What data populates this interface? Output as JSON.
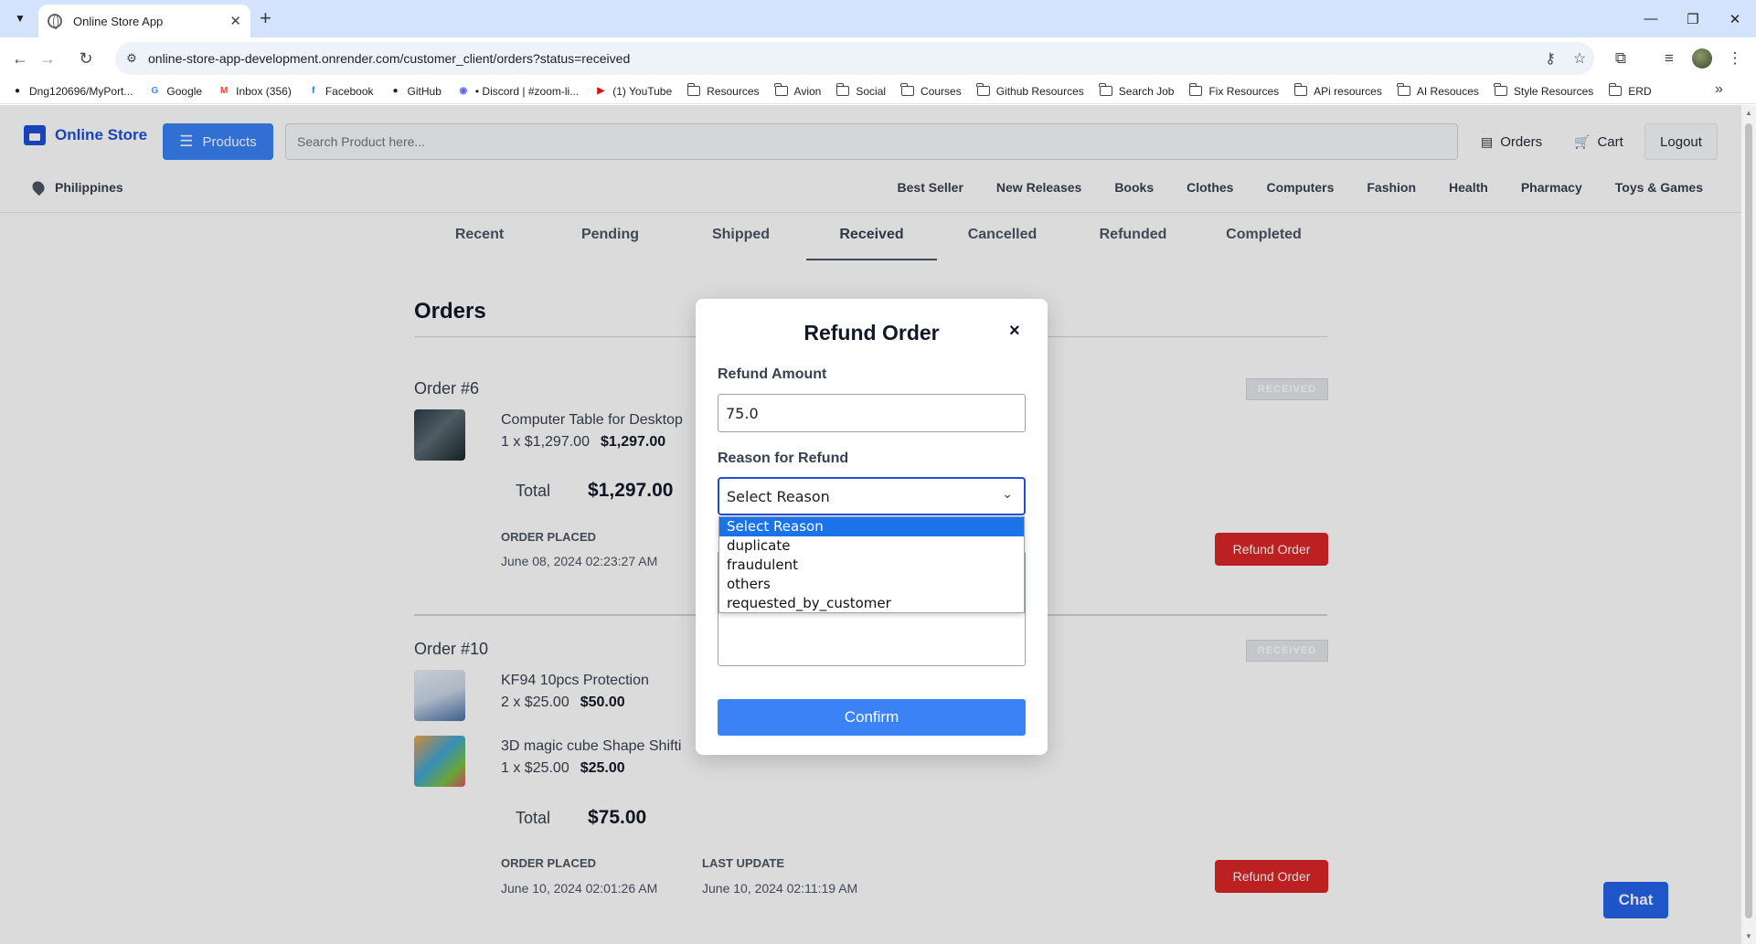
{
  "browser": {
    "tab_title": "Online Store App",
    "url": "online-store-app-development.onrender.com/customer_client/orders?status=received",
    "bookmarks": [
      {
        "label": "Dng120696/MyPort...",
        "icon": "github-icon"
      },
      {
        "label": "Google",
        "icon": "google-icon"
      },
      {
        "label": "Inbox (356)",
        "icon": "gmail-icon"
      },
      {
        "label": "Facebook",
        "icon": "facebook-icon"
      },
      {
        "label": "GitHub",
        "icon": "github-icon"
      },
      {
        "label": "• Discord | #zoom-li...",
        "icon": "discord-icon"
      },
      {
        "label": "(1) YouTube",
        "icon": "youtube-icon"
      },
      {
        "label": "Resources",
        "icon": "folder-icon"
      },
      {
        "label": "Avion",
        "icon": "folder-icon"
      },
      {
        "label": "Social",
        "icon": "folder-icon"
      },
      {
        "label": "Courses",
        "icon": "folder-icon"
      },
      {
        "label": "Github Resources",
        "icon": "folder-icon"
      },
      {
        "label": "Search Job",
        "icon": "folder-icon"
      },
      {
        "label": "Fix Resources",
        "icon": "folder-icon"
      },
      {
        "label": "APi resources",
        "icon": "folder-icon"
      },
      {
        "label": "AI Resouces",
        "icon": "folder-icon"
      },
      {
        "label": "Style Resources",
        "icon": "folder-icon"
      },
      {
        "label": "ERD",
        "icon": "folder-icon"
      }
    ]
  },
  "header": {
    "brand": "Online Store",
    "products_label": "Products",
    "search_placeholder": "Search Product here...",
    "orders_label": "Orders",
    "cart_label": "Cart",
    "logout_label": "Logout",
    "location": "Philippines",
    "categories": [
      "Best Seller",
      "New Releases",
      "Books",
      "Clothes",
      "Computers",
      "Fashion",
      "Health",
      "Pharmacy",
      "Toys & Games"
    ]
  },
  "status_tabs": {
    "items": [
      "Recent",
      "Pending",
      "Shipped",
      "Received",
      "Cancelled",
      "Refunded",
      "Completed"
    ],
    "active": "Received"
  },
  "orders": {
    "title": "Orders",
    "list": [
      {
        "label": "Order #6",
        "badge": "RECEIVED",
        "items": [
          {
            "name": "Computer Table for Desktop",
            "qty": "1 x $1,297.00",
            "subtotal": "$1,297.00"
          }
        ],
        "total_label": "Total",
        "total": "$1,297.00",
        "placed_label": "ORDER PLACED",
        "placed": "June 08, 2024 02:23:27 AM",
        "refund_label": "Refund Order"
      },
      {
        "label": "Order #10",
        "badge": "RECEIVED",
        "items": [
          {
            "name": "KF94 10pcs Protection",
            "qty": "2 x $25.00",
            "subtotal": "$50.00"
          },
          {
            "name": "3D magic cube Shape Shifti",
            "qty": "1 x $25.00",
            "subtotal": "$25.00"
          }
        ],
        "total_label": "Total",
        "total": "$75.00",
        "placed_label": "ORDER PLACED",
        "placed": "June 10, 2024 02:01:26 AM",
        "update_label": "LAST UPDATE",
        "updated": "June 10, 2024 02:11:19 AM",
        "refund_label": "Refund Order"
      }
    ]
  },
  "chat_label": "Chat",
  "modal": {
    "title": "Refund Order",
    "close": "×",
    "amount_label": "Refund Amount",
    "amount_value": "75.0",
    "reason_label": "Reason for Refund",
    "reason_selected": "Select Reason",
    "reason_options": [
      "Select Reason",
      "duplicate",
      "fraudulent",
      "others",
      "requested_by_customer"
    ],
    "confirm_label": "Confirm"
  },
  "colors": {
    "primary": "#3b82f6",
    "brand": "#1d4ed8",
    "danger": "#dc2626",
    "chat": "#2563eb"
  }
}
